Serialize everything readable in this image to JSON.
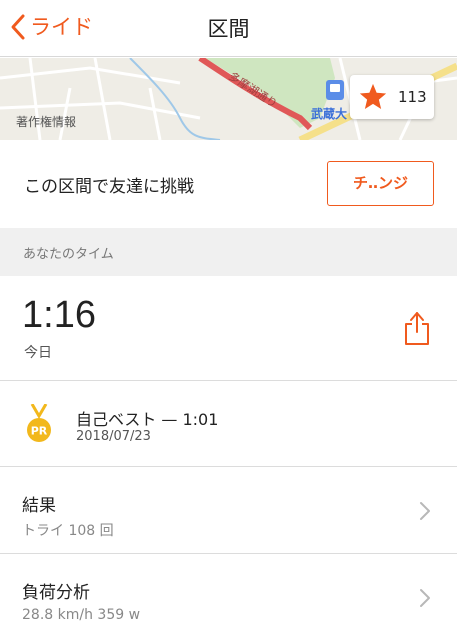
{
  "nav": {
    "back_label": "ライド",
    "title": "区間"
  },
  "map": {
    "attribution": "著作権情報",
    "road_label": "多摩湖通り",
    "station_label": "武蔵大",
    "star_count": "113"
  },
  "challenge": {
    "text": "この区間で友達に挑戦",
    "button_label": "チ‥ンジ"
  },
  "section_header": "あなたのタイム",
  "time": {
    "value": "1:16",
    "label": "今日"
  },
  "pr": {
    "badge": "PR",
    "title": "自己ベスト — 1:01",
    "date": "2018/07/23"
  },
  "results": {
    "title": "結果",
    "subtitle": "トライ 108 回"
  },
  "effort": {
    "title": "負荷分析",
    "subtitle": "28.8 km/h 359 w"
  },
  "colors": {
    "accent": "#f05a1e",
    "medal": "#f2b81c",
    "section_bg": "#f0f0f0"
  }
}
